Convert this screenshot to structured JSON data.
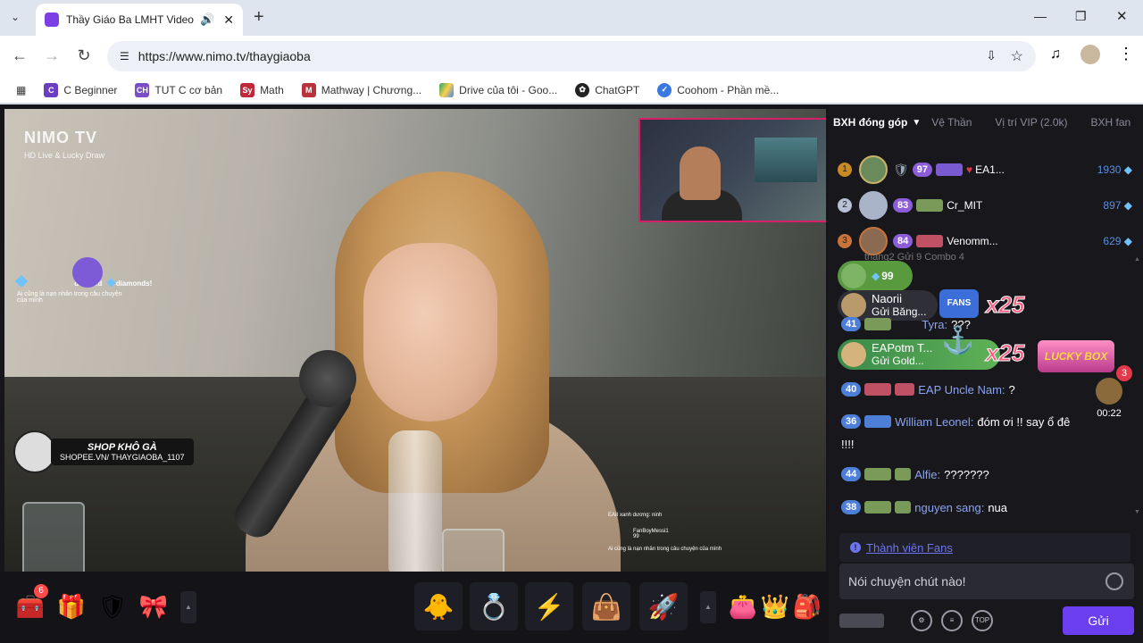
{
  "browser": {
    "tab_title": "Thầy Giáo Ba LMHT Video P",
    "url": "https://www.nimo.tv/thaygiaoba",
    "bookmarks": [
      {
        "label": "C Beginner",
        "icon": "c-icon"
      },
      {
        "label": "TUT C cơ bản",
        "icon": "ch-icon"
      },
      {
        "label": "Math",
        "icon": "sy-icon"
      },
      {
        "label": "Mathway | Chương...",
        "icon": "mathway-icon"
      },
      {
        "label": "Drive của tôi - Goo...",
        "icon": "drive-icon"
      },
      {
        "label": "ChatGPT",
        "icon": "chatgpt-icon"
      },
      {
        "label": "Coohom - Phần mề...",
        "icon": "coohom-icon"
      }
    ]
  },
  "video": {
    "logo_brand": "NIMO TV",
    "logo_sub": "HD Live & Lucky Draw",
    "donate_text": "donated",
    "donate_suffix": "diamonds!",
    "donate_caption": "Ai cũng là nạn nhân trong câu chuyện của mình",
    "shop_title": "SHOP KHÔ GÀ",
    "shop_url": "SHOPEE.VN/ THAYGIAOBA_1107",
    "mini_chat_1": "EAII xanh dương: ninh",
    "mini_chat_2": "FanBoyMessi1",
    "mini_chat_3": "Ai cũng là nạn nhân trong câu chuyện của mình",
    "mini_chat_lvl": "99"
  },
  "bottombar": {
    "chest_badge": "6"
  },
  "side": {
    "tabs": {
      "contrib": "BXH đóng góp",
      "guard": "Vệ Thần",
      "vip": "Vị trí VIP (2.0k)",
      "fans": "BXH fan"
    },
    "ranking": [
      {
        "rank": "1",
        "level": "97",
        "name": "EA1...",
        "value": "1930"
      },
      {
        "rank": "2",
        "level": "83",
        "name": "Cr_MIT",
        "value": "897"
      },
      {
        "rank": "3",
        "level": "84",
        "name": "Venomm...",
        "value": "629"
      }
    ],
    "combo_1": {
      "level": "99"
    },
    "combo_2": {
      "name": "Naorii",
      "action": "Gửi",
      "gift": "Băng...",
      "multiplier": "x25"
    },
    "combo_3": {
      "name": "EAPotm T...",
      "action": "Gửi",
      "gift": "Gold...",
      "multiplier": "x25"
    },
    "partial_line": "thang2  Gửi       9  Combo 4",
    "row_41": {
      "level": "41",
      "name": "Tyra:",
      "text": "???"
    },
    "messages": [
      {
        "level": "40",
        "name": "EAP Uncle Nam:",
        "text": "?"
      },
      {
        "level": "36",
        "name": "William Leonel:",
        "text": "đóm ơi !! say ổ đê"
      },
      {
        "level": "44",
        "name": "Alfie:",
        "text": "???????"
      },
      {
        "level": "38",
        "name": "nguyen sang:",
        "text": "nua"
      }
    ],
    "exclam": "!!!!",
    "lucky_box": "LUCKY BOX",
    "timer": "00:22",
    "timer_badge": "3",
    "fans_link": "Thành viên Fans",
    "input_placeholder": "Nói chuyện chút nào!",
    "send_label": "Gửi"
  }
}
